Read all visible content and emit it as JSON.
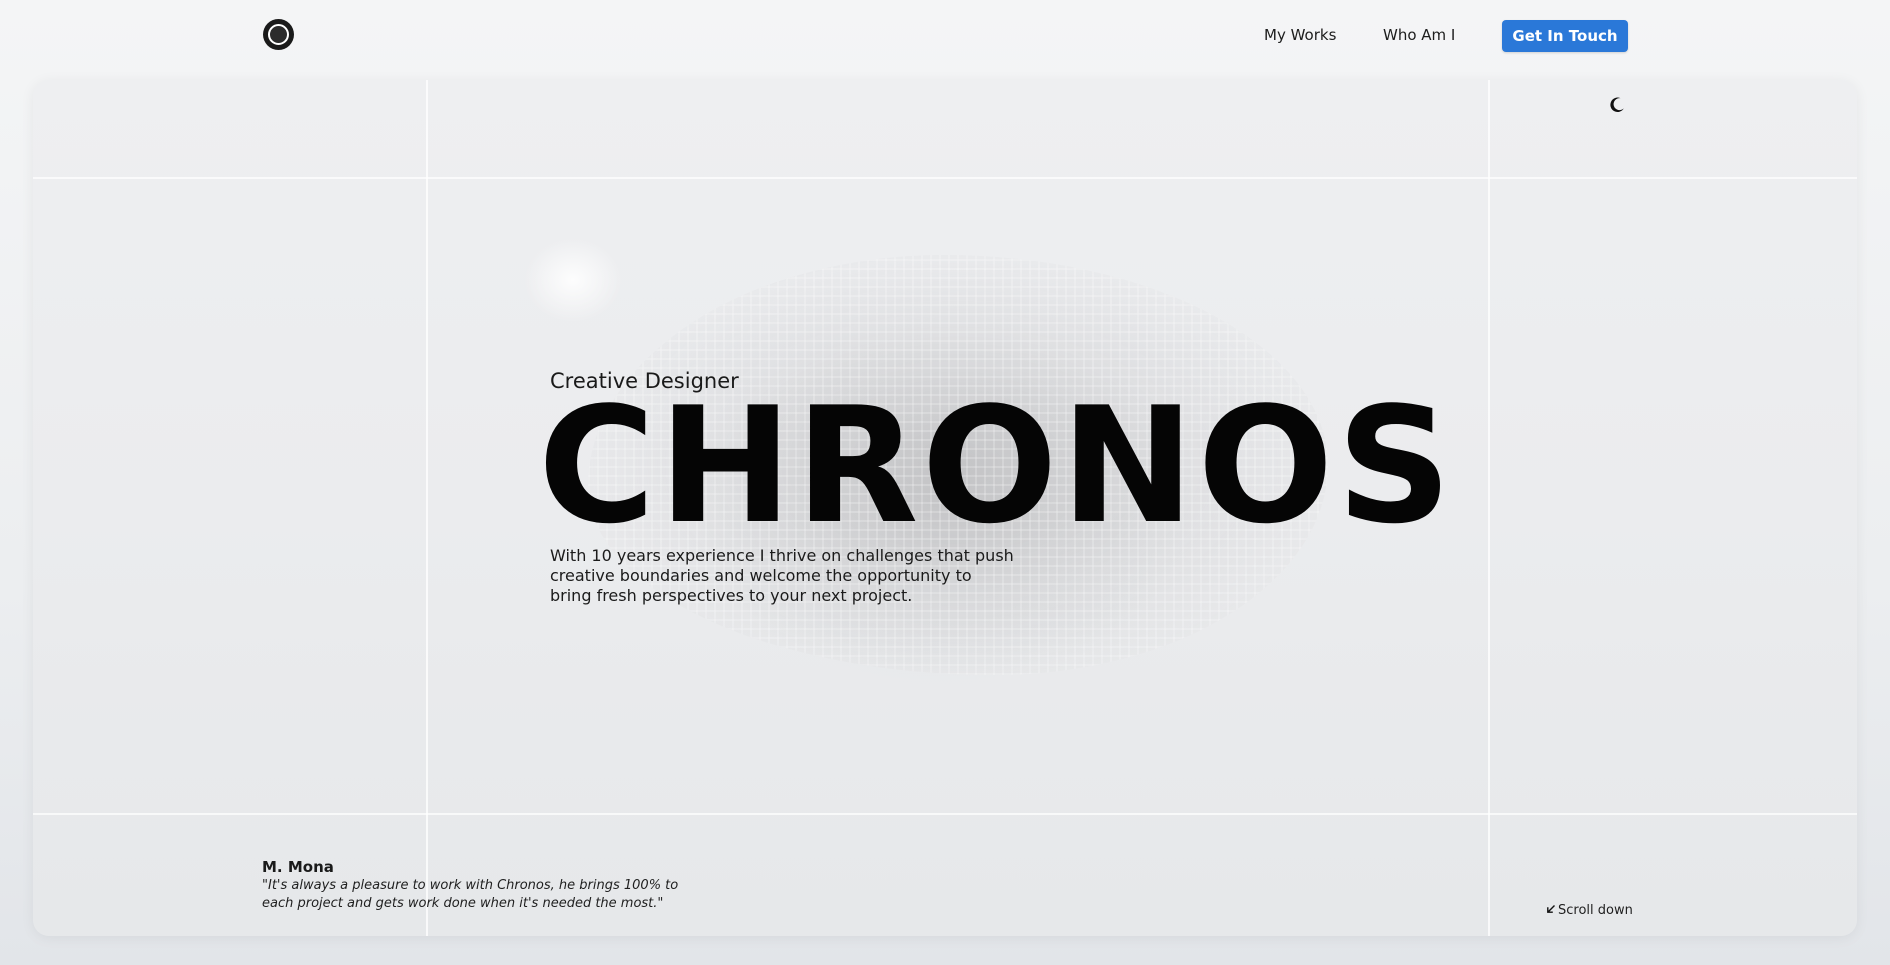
{
  "nav": {
    "logo": "circle-logo-icon",
    "links": [
      {
        "label": "My Works"
      },
      {
        "label": "Who Am I"
      }
    ],
    "cta_label": "Get In Touch"
  },
  "colors": {
    "accent": "#2a78d8",
    "background": "#eeeff1",
    "text": "#050505"
  },
  "theme_toggle_icon": "moon-icon",
  "hero": {
    "eyebrow": "Creative Designer",
    "title": "CHRONOS",
    "intro_lines": [
      "With 10 years experience I thrive on challenges that push",
      "creative boundaries and welcome the opportunity to",
      "bring fresh perspectives to your next project."
    ]
  },
  "testimonial": {
    "name": "M. Mona",
    "quote_lines": [
      "\"It's always a pleasure to work with Chronos, he brings 100% to",
      "each project and gets work done when it's needed the most.\""
    ]
  },
  "scroll": {
    "arrow_icon": "arrow-down-left-icon",
    "label": "Scroll down"
  }
}
